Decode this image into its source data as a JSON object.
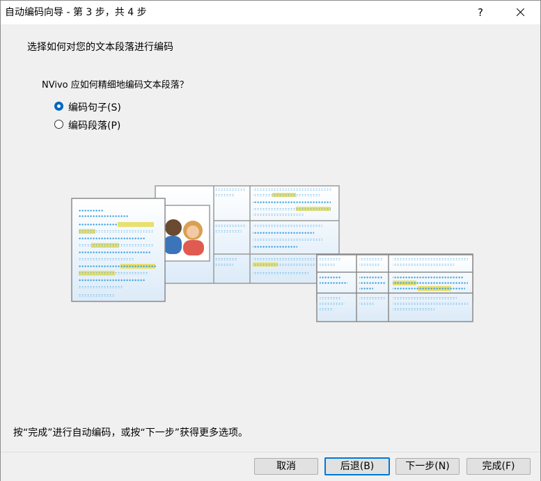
{
  "window": {
    "title": "自动编码向导 - 第 3 步，共 4 步",
    "help_label": "?"
  },
  "content": {
    "heading": "选择如何对您的文本段落进行编码",
    "question": "NVivo 应如何精细地编码文本段落？",
    "options": [
      {
        "label": "编码句子(S)",
        "selected": true
      },
      {
        "label": "编码段落(P)",
        "selected": false
      }
    ],
    "footer_hint": "按“完成”进行自动编码，或按“下一步”获得更多选项。"
  },
  "buttons": {
    "cancel": "取消",
    "back": "后退(B)",
    "next": "下一步(N)",
    "finish": "完成(F)"
  },
  "colors": {
    "accent": "#0078d7",
    "radio_selected": "#0067c0",
    "dot_blue": "#3aa0e0",
    "highlight": "#e8e070"
  }
}
